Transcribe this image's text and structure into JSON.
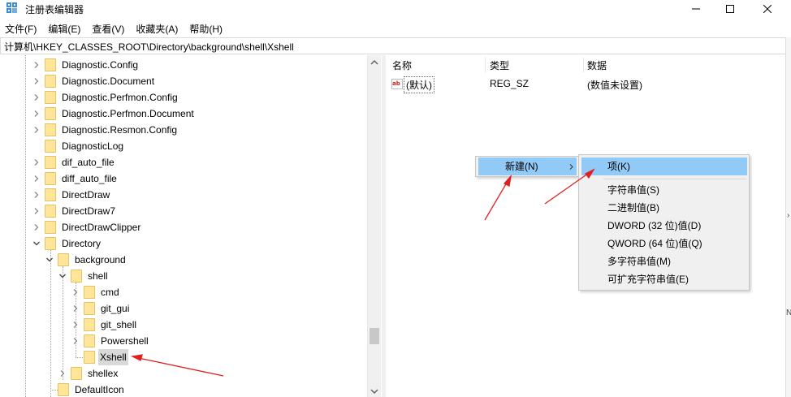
{
  "window": {
    "title": "注册表编辑器",
    "accent_color": "#91c9f7"
  },
  "menubar": {
    "items": [
      {
        "label": "文件(F)"
      },
      {
        "label": "编辑(E)"
      },
      {
        "label": "查看(V)"
      },
      {
        "label": "收藏夹(A)"
      },
      {
        "label": "帮助(H)"
      }
    ]
  },
  "address": {
    "path": "计算机\\HKEY_CLASSES_ROOT\\Directory\\background\\shell\\Xshell"
  },
  "tree": {
    "items": [
      {
        "label": "Diagnostic.Config",
        "expandable": true,
        "expanded": false
      },
      {
        "label": "Diagnostic.Document",
        "expandable": true,
        "expanded": false
      },
      {
        "label": "Diagnostic.Perfmon.Config",
        "expandable": true,
        "expanded": false
      },
      {
        "label": "Diagnostic.Perfmon.Document",
        "expandable": true,
        "expanded": false
      },
      {
        "label": "Diagnostic.Resmon.Config",
        "expandable": true,
        "expanded": false
      },
      {
        "label": "DiagnosticLog",
        "expandable": false,
        "expanded": false
      },
      {
        "label": "dif_auto_file",
        "expandable": true,
        "expanded": false
      },
      {
        "label": "diff_auto_file",
        "expandable": true,
        "expanded": false
      },
      {
        "label": "DirectDraw",
        "expandable": true,
        "expanded": false
      },
      {
        "label": "DirectDraw7",
        "expandable": true,
        "expanded": false
      },
      {
        "label": "DirectDrawClipper",
        "expandable": true,
        "expanded": false
      },
      {
        "label": "Directory",
        "expandable": true,
        "expanded": true
      },
      {
        "label": "background",
        "expandable": true,
        "expanded": true
      },
      {
        "label": "shell",
        "expandable": true,
        "expanded": true
      },
      {
        "label": "cmd",
        "expandable": true,
        "expanded": false
      },
      {
        "label": "git_gui",
        "expandable": true,
        "expanded": false
      },
      {
        "label": "git_shell",
        "expandable": true,
        "expanded": false
      },
      {
        "label": "Powershell",
        "expandable": true,
        "expanded": false
      },
      {
        "label": "Xshell",
        "expandable": false,
        "expanded": false,
        "selected": true
      },
      {
        "label": "shellex",
        "expandable": true,
        "expanded": false
      },
      {
        "label": "DefaultIcon",
        "expandable": false,
        "expanded": false
      }
    ]
  },
  "list": {
    "headers": {
      "name": "名称",
      "type": "类型",
      "data": "数据"
    },
    "rows": [
      {
        "name": "(默认)",
        "type": "REG_SZ",
        "data": "(数值未设置)"
      }
    ]
  },
  "context_menu": {
    "new_label": "新建(N)",
    "submenu": {
      "items": [
        {
          "label": "项(K)"
        },
        {
          "label": "字符串值(S)"
        },
        {
          "label": "二进制值(B)"
        },
        {
          "label": "DWORD (32 位)值(D)"
        },
        {
          "label": "QWORD (64 位)值(Q)"
        },
        {
          "label": "多字符串值(M)"
        },
        {
          "label": "可扩充字符串值(E)"
        }
      ]
    }
  },
  "annotations": {
    "arrow_color": "#e02020"
  }
}
